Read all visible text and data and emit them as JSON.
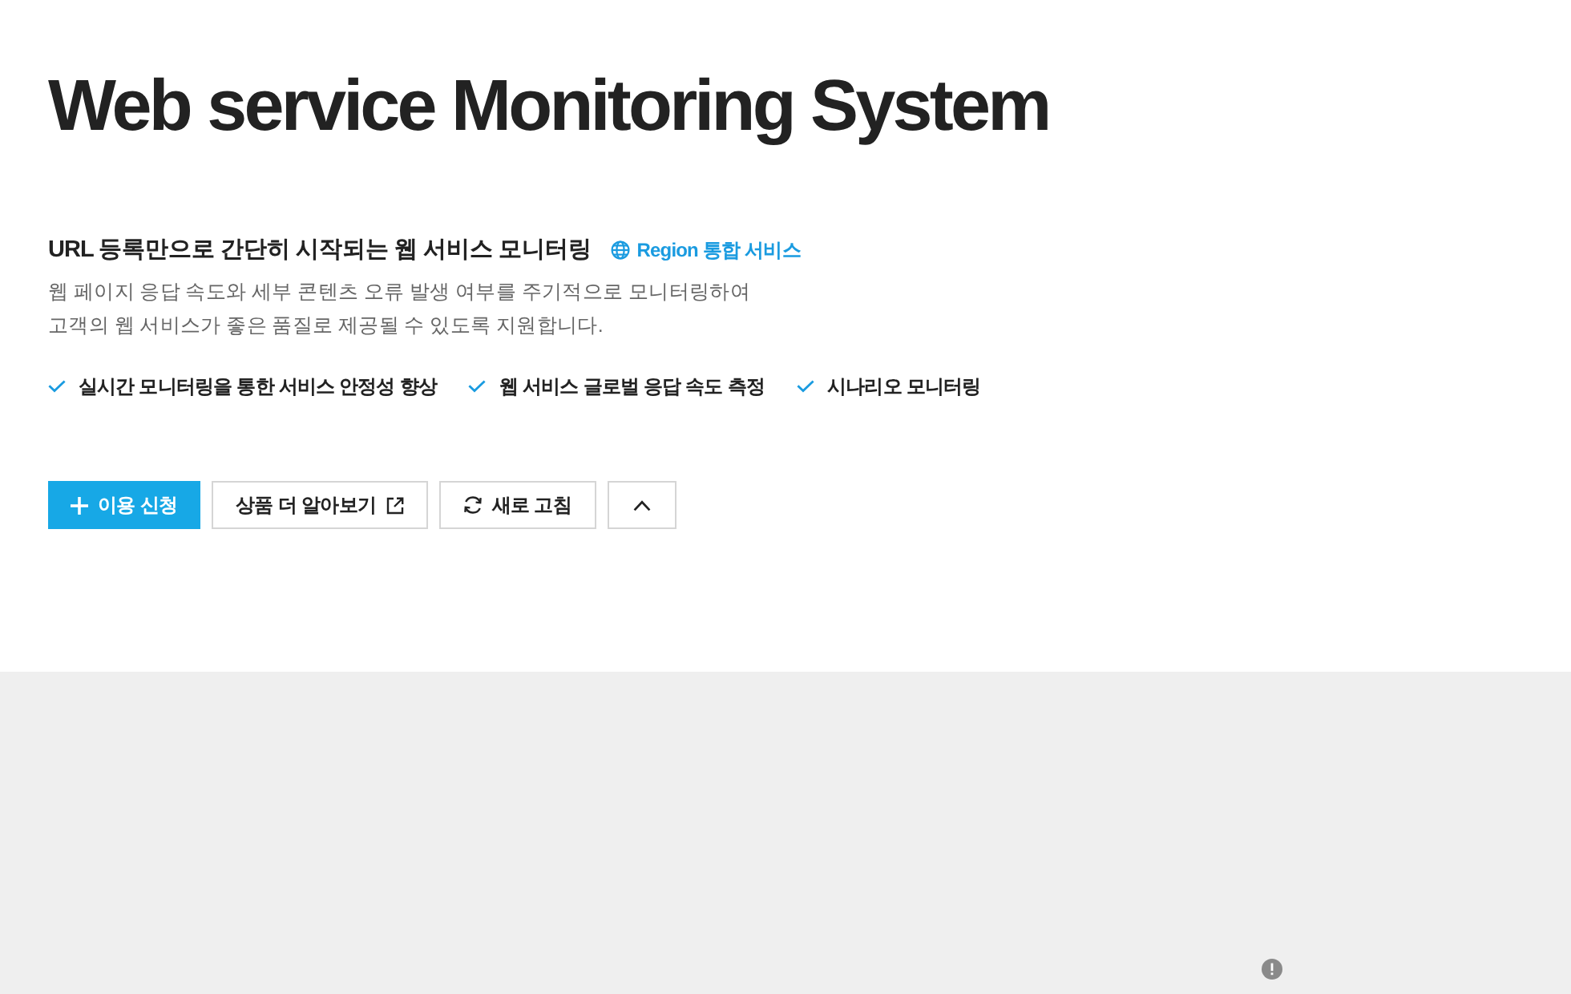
{
  "title": "Web service Monitoring System",
  "summary": {
    "heading": "URL 등록만으로 간단히 시작되는 웹 서비스 모니터링",
    "badge": {
      "label": "Region 통합 서비스"
    }
  },
  "description": [
    "웹 페이지 응답 속도와 세부 콘텐츠 오류 발생 여부를 주기적으로 모니터링하여",
    "고객의 웹 서비스가 좋은 품질로 제공될 수 있도록 지원합니다."
  ],
  "features": [
    "실시간 모니터링을 통한 서비스 안정성 향상",
    "웹 서비스 글로벌 응답 속도 측정",
    "시나리오 모니터링"
  ],
  "buttons": [
    {
      "kind": "primary",
      "label": "이용 신청"
    },
    {
      "kind": "external",
      "label": "상품 더 알아보기"
    },
    {
      "kind": "refresh",
      "label": "새로 고침"
    },
    {
      "kind": "collapse",
      "expanded": true
    }
  ]
}
